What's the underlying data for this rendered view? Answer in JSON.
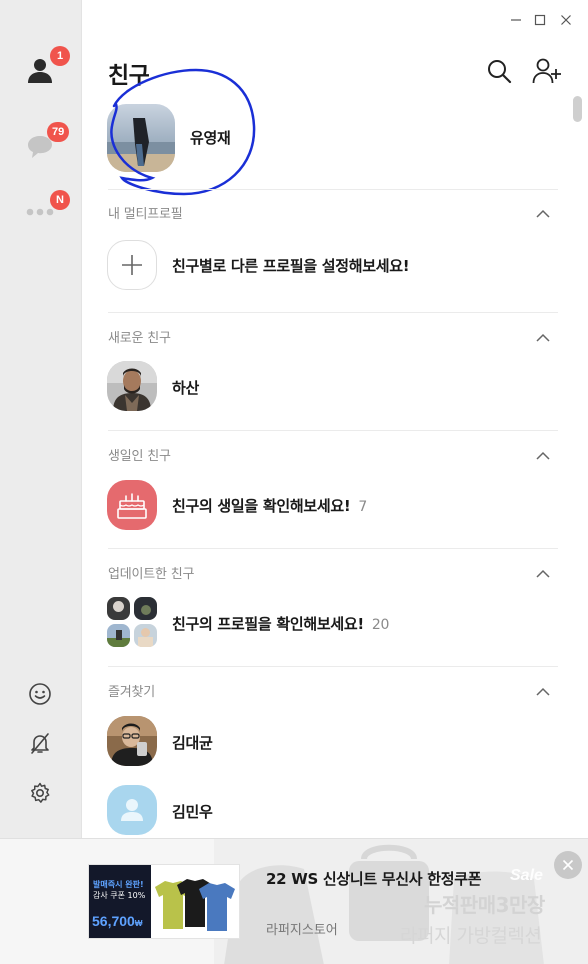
{
  "header": {
    "title": "친구"
  },
  "rail": {
    "friends_badge": "1",
    "chats_badge": "79",
    "more_badge": "N"
  },
  "profile": {
    "name": "유영재"
  },
  "sections": {
    "multi": {
      "label": "내 멀티프로필",
      "cta": "친구별로 다른 프로필을 설정해보세요!"
    },
    "new": {
      "label": "새로운 친구",
      "friend": "하산"
    },
    "birthday": {
      "label": "생일인 친구",
      "cta": "친구의 생일을 확인해보세요!",
      "count": "7"
    },
    "updated": {
      "label": "업데이트한 친구",
      "cta": "친구의 프로필을 확인해보세요!",
      "count": "20"
    },
    "favorites": {
      "label": "즐겨찾기",
      "friends": [
        "김대균",
        "김민우"
      ]
    }
  },
  "ad": {
    "title": "22 WS 신상니트 무신사 한정쿠폰",
    "store": "라퍼지스토어",
    "thumb_line1": "발매즉시 완판!",
    "thumb_line2": "감사 쿠폰 10%",
    "thumb_price": "56,700",
    "thumb_price_unit": "₩",
    "bg_text1": "누적판매3만장",
    "bg_text2": "라퍼지 가방컬렉션",
    "bg_text3": "Sale"
  },
  "colors": {
    "accent_red": "#f0544c",
    "birthday_bg": "#e56a6e",
    "rail_bg": "#ececec"
  }
}
